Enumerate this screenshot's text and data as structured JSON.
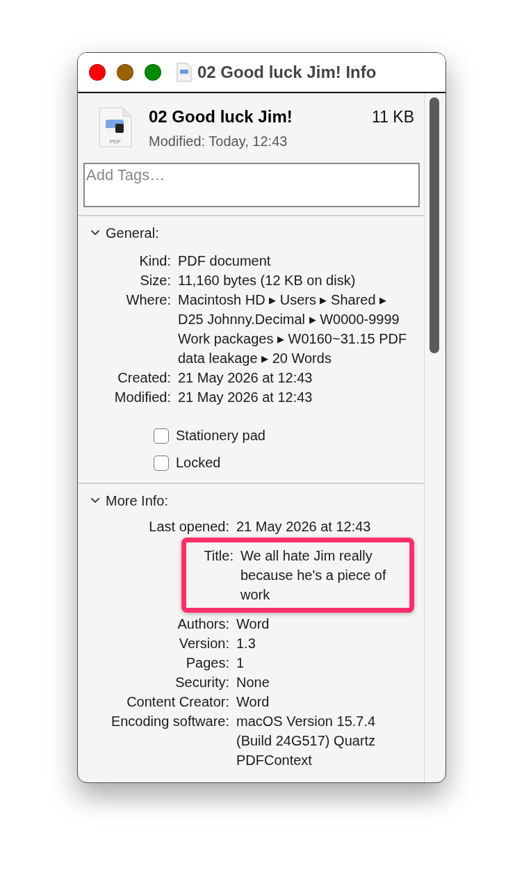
{
  "window": {
    "title": "02 Good luck Jim! Info"
  },
  "header": {
    "name": "02 Good luck Jim!",
    "size": "11 KB",
    "modified": "Modified: Today, 12:43",
    "file_badge": "PDF"
  },
  "tags": {
    "placeholder": "Add Tags…"
  },
  "general": {
    "title": "General:",
    "expanded": true,
    "rows": [
      {
        "label": "Kind:",
        "value": "PDF document"
      },
      {
        "label": "Size:",
        "value": "11,160 bytes (12 KB on disk)"
      },
      {
        "label": "Where:",
        "value": "Macintosh HD ▸ Users ▸ Shared ▸ D25 Johnny.Decimal ▸ W0000-9999 Work packages ▸ W0160~31.15 PDF data leakage ▸ 20 Words"
      },
      {
        "label": "Created:",
        "value": "21 May 2026 at 12:43"
      },
      {
        "label": "Modified:",
        "value": "21 May 2026 at 12:43"
      }
    ],
    "checkboxes": [
      {
        "label": "Stationery pad",
        "checked": false
      },
      {
        "label": "Locked",
        "checked": false
      }
    ]
  },
  "more_info": {
    "title": "More Info:",
    "expanded": true,
    "rows_before": [
      {
        "label": "Last opened:",
        "value": "21 May 2026 at 12:43"
      }
    ],
    "highlight": {
      "label": "Title:",
      "value": "We all hate Jim really because he's a piece of work"
    },
    "rows_after": [
      {
        "label": "Authors:",
        "value": "Word"
      },
      {
        "label": "Version:",
        "value": "1.3"
      },
      {
        "label": "Pages:",
        "value": "1"
      },
      {
        "label": "Security:",
        "value": "None"
      },
      {
        "label": "Content Creator:",
        "value": "Word"
      },
      {
        "label": "Encoding software:",
        "value": "macOS Version 15.7.4 (Build 24G517) Quartz PDFContext"
      }
    ]
  }
}
